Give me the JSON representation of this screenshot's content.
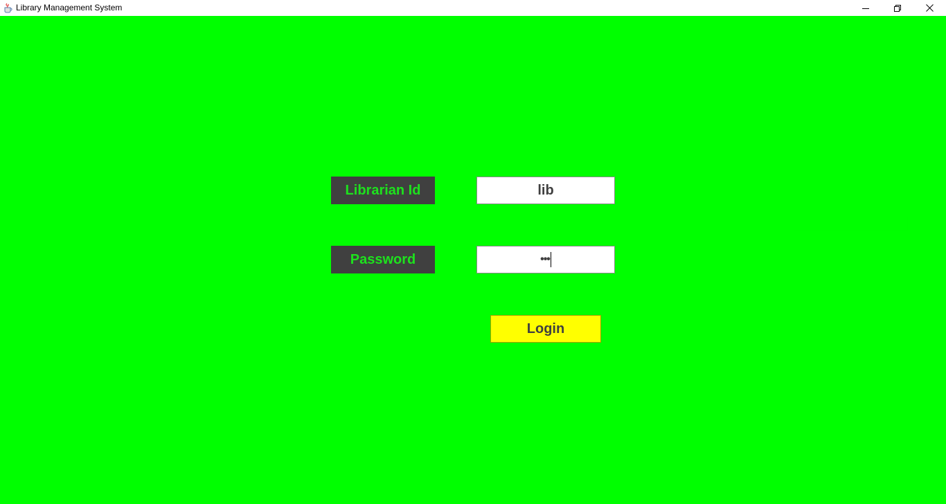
{
  "window": {
    "title": "Library Management System",
    "icons": {
      "app": "java-cup-icon",
      "minimize": "minimize-icon",
      "maximize": "restore-icon",
      "close": "close-icon"
    }
  },
  "form": {
    "librarian_id_label": "Librarian Id",
    "librarian_id_value": "lib",
    "password_label": "Password",
    "password_value": "•••",
    "login_label": "Login"
  },
  "colors": {
    "background": "#00ff00",
    "label_bg": "#404040",
    "label_text": "#1de21d",
    "field_bg": "#ffffff",
    "login_bg": "#ffff00",
    "text_dark": "#404040"
  }
}
